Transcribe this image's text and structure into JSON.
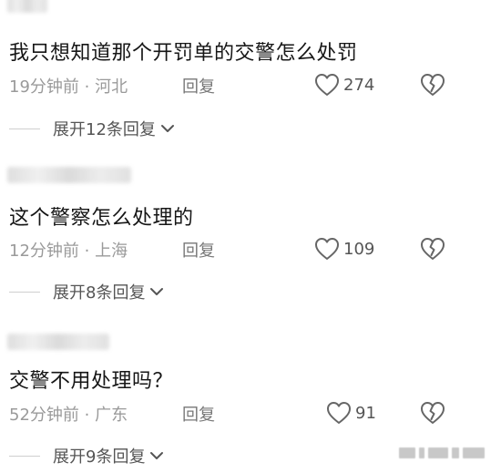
{
  "comments": [
    {
      "text": "我只想知道那个开罚单的交警怎么处罚",
      "time": "19分钟前",
      "location": "河北",
      "reply": "回复",
      "likes": "274",
      "expand": "展开12条回复"
    },
    {
      "text": "这个警察怎么处理的",
      "time": "12分钟前",
      "location": "上海",
      "reply": "回复",
      "likes": "109",
      "expand": "展开8条回复"
    },
    {
      "text": "交警不用处理吗？",
      "time": "52分钟前",
      "location": "广东",
      "reply": "回复",
      "likes": "91",
      "expand": "展开9条回复"
    }
  ],
  "meta_separator": " · ",
  "icons": {
    "like": "heart-outline-icon",
    "dislike": "broken-heart-icon",
    "expand": "chevron-down-icon"
  },
  "colors": {
    "text": "#161616",
    "meta": "#9a9a9a",
    "reply": "#777777",
    "icon": "#666666"
  }
}
